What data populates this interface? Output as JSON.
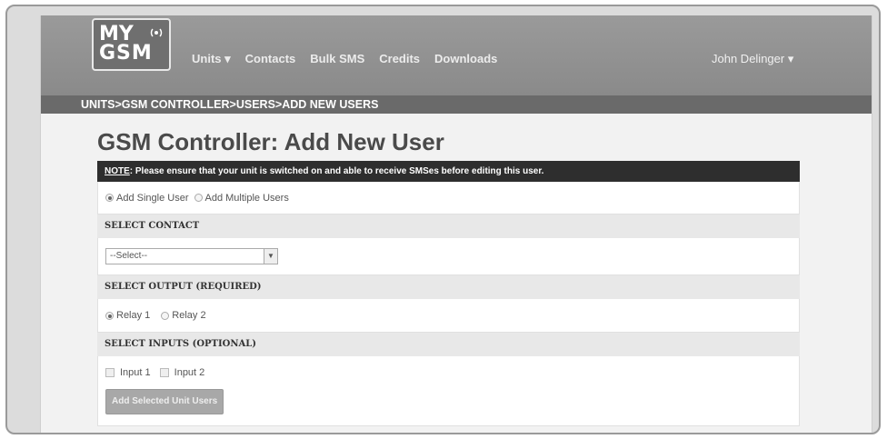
{
  "logo": {
    "line1": "MY",
    "line2": "GSM"
  },
  "nav": {
    "units": "Units",
    "contacts": "Contacts",
    "bulk_sms": "Bulk SMS",
    "credits": "Credits",
    "downloads": "Downloads"
  },
  "user": {
    "name": "John Delinger"
  },
  "breadcrumb": "UNITS>GSM CONTROLLER>USERS>ADD NEW USERS",
  "page_title": "GSM Controller: Add New User",
  "note": {
    "label": "NOTE",
    "text": ": Please ensure that your unit is switched on and able to receive SMSes before editing this user."
  },
  "mode": {
    "single": "Add Single User",
    "multiple": "Add Multiple Users",
    "selected": "single"
  },
  "contact": {
    "heading": "SELECT CONTACT",
    "select_value": "--Select--"
  },
  "output": {
    "heading": "SELECT OUTPUT (REQUIRED)",
    "relay1": "Relay 1",
    "relay2": "Relay 2",
    "selected": "relay1"
  },
  "inputs": {
    "heading": "SELECT INPUTS (OPTIONAL)",
    "input1": "Input 1",
    "input2": "Input 2"
  },
  "submit_label": "Add Selected Unit Users"
}
